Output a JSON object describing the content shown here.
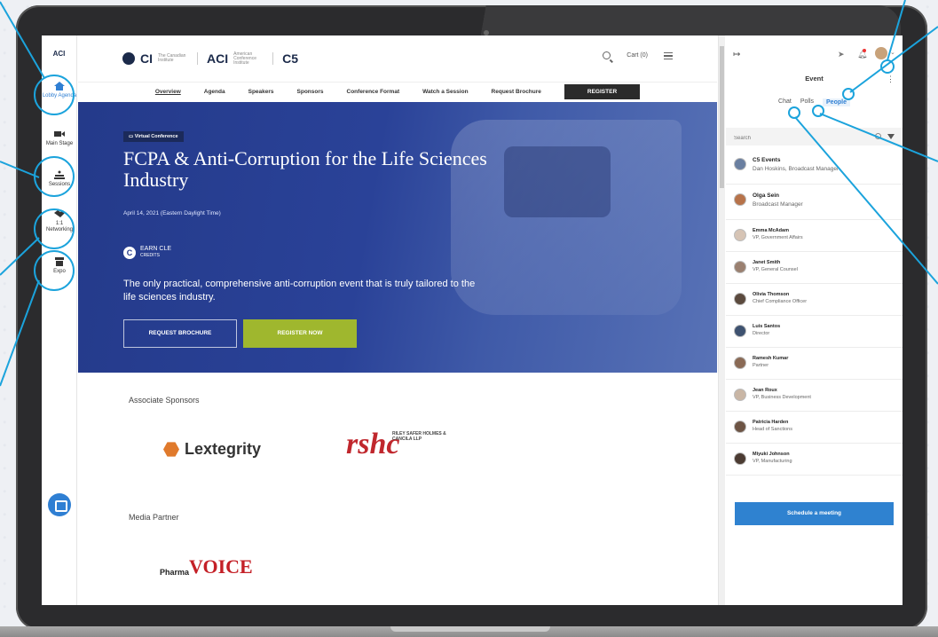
{
  "rail": {
    "logo": "ACI",
    "items": [
      {
        "label": "Lobby Agenda",
        "icon": "home-icon"
      },
      {
        "label": "Main Stage",
        "icon": "video-camera-icon"
      },
      {
        "label": "Sessions",
        "icon": "audience-icon"
      },
      {
        "label": "1:1 Networking",
        "icon": "handshake-icon"
      },
      {
        "label": "Expo",
        "icon": "booth-icon"
      }
    ]
  },
  "header": {
    "brand_ci": "CI",
    "brand_ci_small": "The Canadian Institute",
    "brand_aci": "ACI",
    "brand_aci_small": "American Conference Institute",
    "brand_c5": "C5",
    "cart": "Cart (0)"
  },
  "nav": {
    "links": [
      "Overview",
      "Agenda",
      "Speakers",
      "Sponsors",
      "Conference Format",
      "Watch a Session",
      "Request Brochure"
    ],
    "register": "REGISTER"
  },
  "hero": {
    "tag": "Virtual Conference",
    "title": "FCPA & Anti-Corruption for the Life Sciences Industry",
    "date": "April 14, 2021 (Eastern Daylight Time)",
    "cle_line1": "EARN CLE",
    "cle_line2": "CREDITS",
    "description": "The only practical, comprehensive anti-corruption event that is truly tailored to the life sciences industry.",
    "btn_brochure": "REQUEST BROCHURE",
    "btn_register": "REGISTER NOW"
  },
  "sponsors": {
    "associate_heading": "Associate Sponsors",
    "lextegrity": "Lextegrity",
    "rshc_mark": "rshc",
    "rshc_sub": "RILEY SAFER HOLMES & CANCILA LLP",
    "media_heading": "Media Partner",
    "pharma_p1": "Pharma",
    "pharma_p2": "VOICE"
  },
  "panel": {
    "title": "Event",
    "tabs": [
      "Chat",
      "Polls",
      "People"
    ],
    "active_tab": "People",
    "search_placeholder": "Search",
    "people": [
      {
        "name": "C5 Events",
        "role": "Dan Hoskins, Broadcast Manager"
      },
      {
        "name": "Olga Sein",
        "role": "Broadcast Manager"
      },
      {
        "name": "Emma McAdam",
        "role": "VP, Government Affairs"
      },
      {
        "name": "Janet Smith",
        "role": "VP, General Counsel"
      },
      {
        "name": "Olivia Thomson",
        "role": "Chief Compliance Officer"
      },
      {
        "name": "Luis Santos",
        "role": "Director"
      },
      {
        "name": "Ramesh Kumar",
        "role": "Partner"
      },
      {
        "name": "Jean Roux",
        "role": "VP, Business Development"
      },
      {
        "name": "Patricia Harden",
        "role": "Head of Sanctions"
      },
      {
        "name": "Miyuki Johnson",
        "role": "VP, Manufacturing"
      }
    ],
    "schedule_button": "Schedule a meeting"
  },
  "colors": {
    "accent": "#2f7fd3",
    "callout": "#1ba3dc",
    "hero": "#243a8a",
    "register_green": "#9fb72e"
  }
}
